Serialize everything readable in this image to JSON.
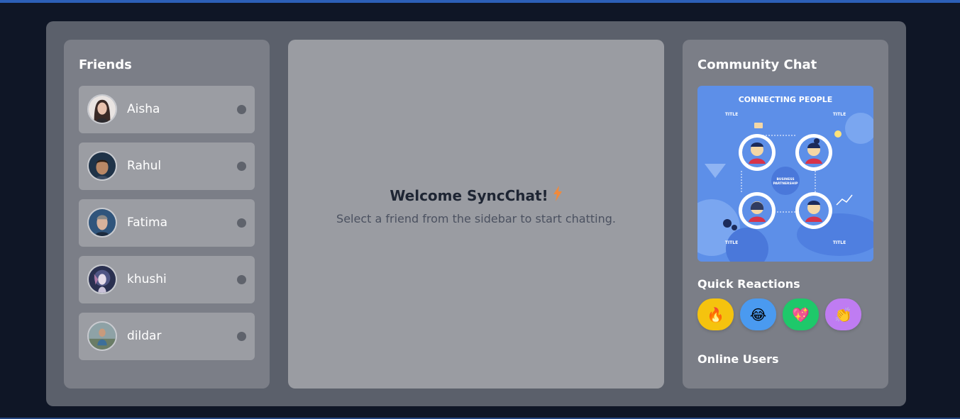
{
  "friends_panel": {
    "title": "Friends",
    "friends": [
      {
        "name": "Aisha"
      },
      {
        "name": "Rahul"
      },
      {
        "name": "Fatima"
      },
      {
        "name": "khushi"
      },
      {
        "name": "dildar"
      }
    ]
  },
  "main": {
    "welcome_title": "Welcome SyncChat!",
    "welcome_emoji": "⚡",
    "welcome_subtitle": "Select a friend from the sidebar to start chatting."
  },
  "community": {
    "title": "Community Chat",
    "image": {
      "heading": "CONNECTING PEOPLE",
      "center_label_1": "BUSINESS",
      "center_label_2": "PARTNERSHIP",
      "corner_label": "TITLE"
    },
    "quick_reactions_title": "Quick Reactions",
    "reactions": [
      {
        "emoji": "🔥",
        "color": "#f5c30e"
      },
      {
        "emoji": "😂",
        "color": "#4a9af0"
      },
      {
        "emoji": "💖",
        "color": "#1ec86a"
      },
      {
        "emoji": "👏",
        "color": "#bf7cf2"
      }
    ],
    "online_users_title": "Online Users"
  },
  "colors": {
    "background": "#0f1626",
    "accent_bar": "#2c5fb7",
    "status_offline": "#5f636c"
  }
}
